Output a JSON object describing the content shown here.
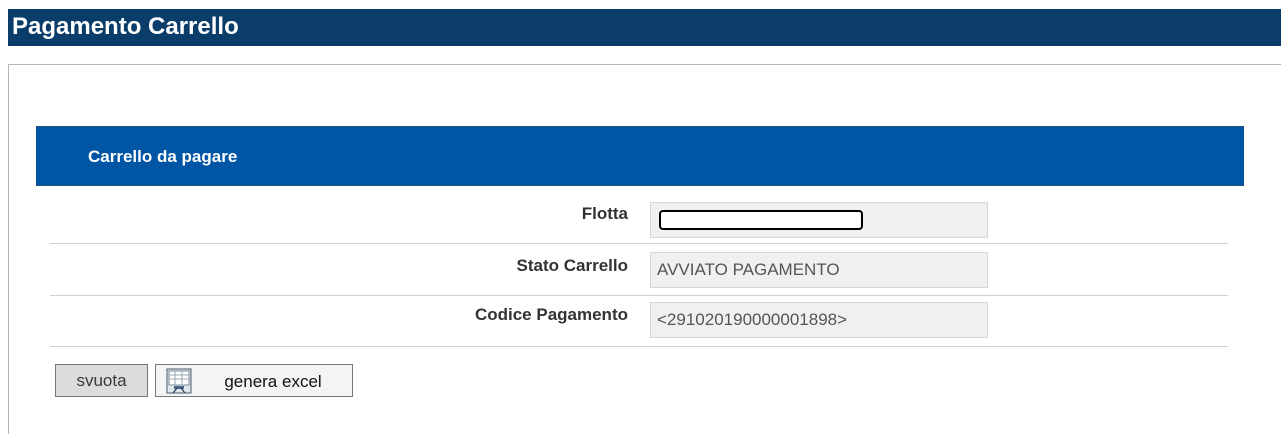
{
  "header": {
    "title": "Pagamento Carrello"
  },
  "panel": {
    "title": "Carrello da pagare"
  },
  "fields": [
    {
      "label": "Flotta",
      "value": ""
    },
    {
      "label": "Stato Carrello",
      "value": "AVVIATO PAGAMENTO"
    },
    {
      "label": "Codice Pagamento",
      "value": "<291020190000001898>"
    }
  ],
  "buttons": {
    "svuota_label": "svuota",
    "excel_label": "genera excel",
    "excel_icon": "spreadsheet-icon"
  },
  "colors": {
    "header_bg": "#0b3d6b",
    "panel_bg": "#0055a5",
    "field_bg": "#f0f0f0"
  }
}
